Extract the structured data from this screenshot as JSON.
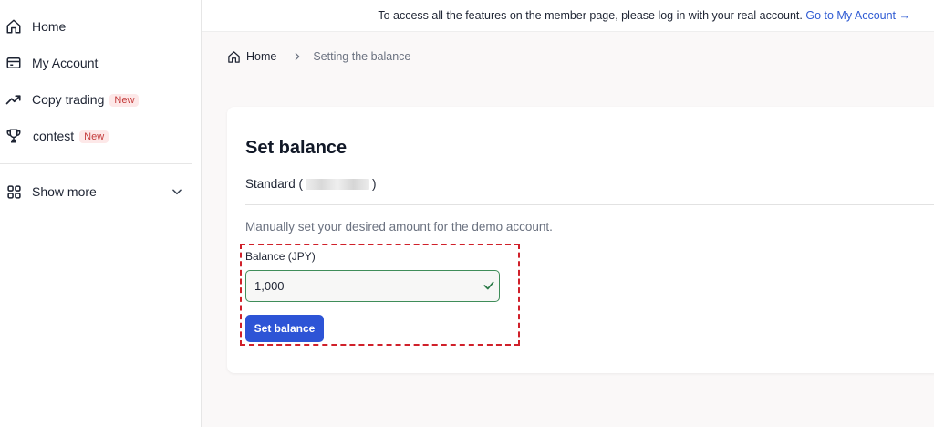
{
  "sidebar": {
    "items": [
      {
        "label": "Home",
        "icon": "home-icon"
      },
      {
        "label": "My Account",
        "icon": "card-icon"
      },
      {
        "label": "Copy trading",
        "icon": "trending-up-icon",
        "badge": "New"
      },
      {
        "label": "contest",
        "icon": "trophy-icon",
        "badge": "New"
      }
    ],
    "show_more": {
      "label": "Show more",
      "icon": "grid-icon"
    }
  },
  "banner": {
    "text": "To access all the features on the member page, please log in with your real account.",
    "link": "Go to My Account →"
  },
  "breadcrumb": {
    "home": "Home",
    "current": "Setting the balance"
  },
  "card": {
    "title": "Set balance",
    "account_prefix": "Standard (",
    "account_suffix": ")",
    "description": "Manually set your desired amount for the demo account.",
    "field_label": "Balance (JPY)",
    "field_value": "1,000",
    "button_label": "Set balance"
  },
  "colors": {
    "accent": "#2d54d6",
    "link": "#2f5bd3",
    "badge_text": "#c43c3c",
    "badge_bg": "#fde8e8",
    "valid_border": "#3f8d59",
    "highlight": "#d0202a"
  }
}
